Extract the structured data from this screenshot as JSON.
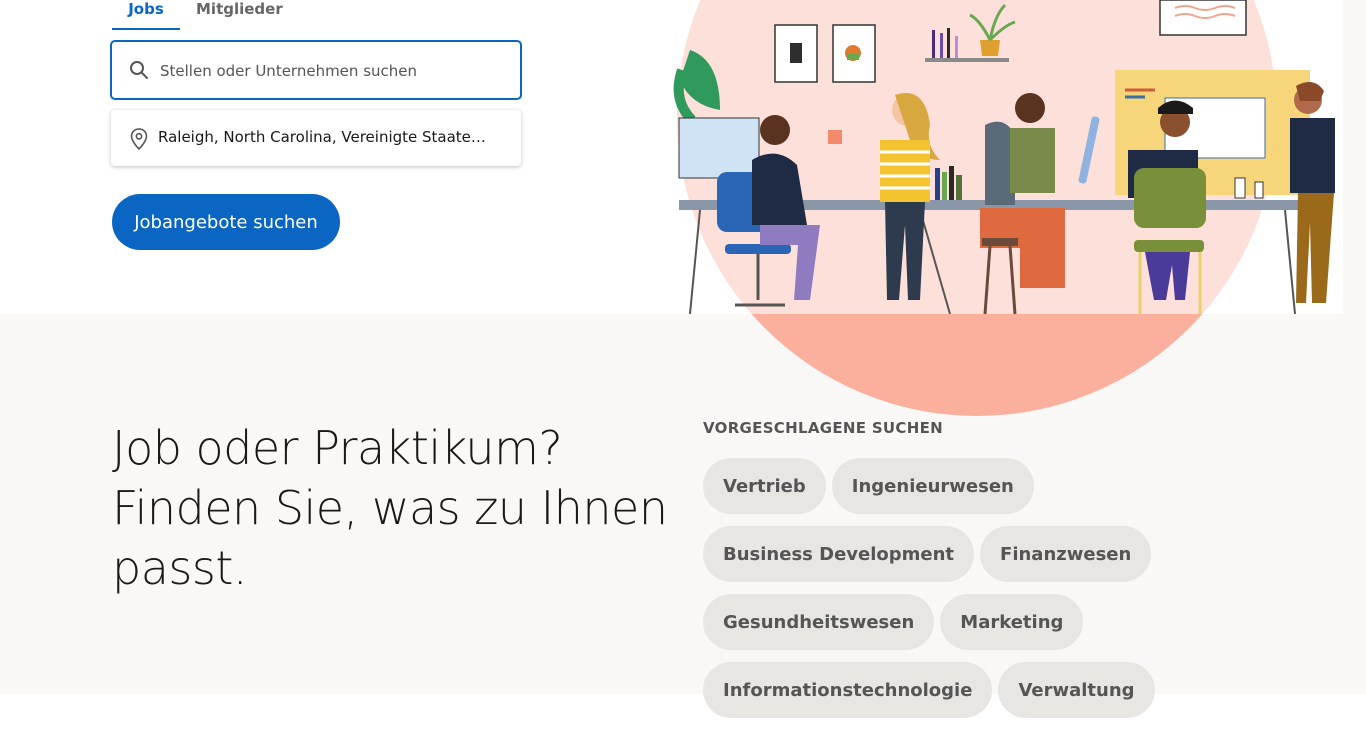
{
  "tabs": [
    {
      "label": "Jobs",
      "active": true
    },
    {
      "label": "Mitglieder",
      "active": false
    }
  ],
  "search": {
    "placeholder": "Stellen oder Unternehmen suchen",
    "value": ""
  },
  "location": {
    "value": "Raleigh, North Carolina, Vereinigte Staaten von Amerika"
  },
  "submit_label": "Jobangebote suchen",
  "hero": {
    "line1": "Job oder Praktikum?",
    "line2": "Finden Sie, was zu Ihnen",
    "line3": "passt."
  },
  "suggested": {
    "heading": "VORGESCHLAGENE SUCHEN",
    "rows": [
      [
        "Vertrieb",
        "Ingenieurwesen"
      ],
      [
        "Business Development",
        "Finanzwesen"
      ],
      [
        "Gesundheitswesen",
        "Marketing"
      ],
      [
        "Informationstechnologie",
        "Verwaltung"
      ]
    ]
  },
  "colors": {
    "accent": "#0a66c2",
    "pill_bg": "#e8e6e3",
    "band_bg": "#f9f8f6",
    "circle_light": "#fde0da",
    "circle_dark": "#fbb09e"
  },
  "icons": {
    "search": "search-icon",
    "location": "location-pin-icon"
  }
}
